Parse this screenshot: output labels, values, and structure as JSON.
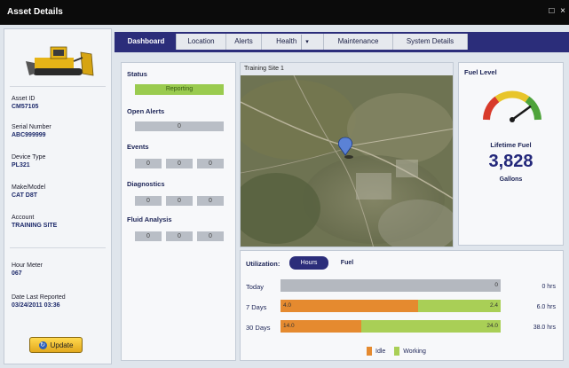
{
  "window": {
    "title": "Asset Details",
    "controls": [
      "□",
      "×"
    ]
  },
  "asset": {
    "fields": [
      {
        "label": "Asset ID",
        "value": "CM57105"
      },
      {
        "label": "Serial Number",
        "value": "ABC999999"
      },
      {
        "label": "Device Type",
        "value": "PL321"
      },
      {
        "label": "Make/Model",
        "value": "CAT D8T"
      },
      {
        "label": "Account",
        "value": "TRAINING SITE"
      },
      {
        "label": "Hour Meter",
        "value": "067"
      },
      {
        "label": "Date Last Reported",
        "value": "03/24/2011 03:36"
      }
    ],
    "update_label": "Update",
    "update_icon": "refresh-icon"
  },
  "tabs": [
    {
      "label": "Dashboard",
      "active": true
    },
    {
      "label": "Location"
    },
    {
      "label": "Alerts"
    },
    {
      "label": "Health",
      "dropdown": "▾"
    },
    {
      "label": "Maintenance"
    },
    {
      "label": "System Details"
    }
  ],
  "status": {
    "status_title": "Status",
    "status_value": "Reporting",
    "open_alerts_title": "Open Alerts",
    "open_alerts_value": "0",
    "events_title": "Events",
    "events_values": [
      "0",
      "0",
      "0"
    ],
    "diagnostics_title": "Diagnostics",
    "diagnostics_values": [
      "0",
      "0",
      "0"
    ],
    "fluid_title": "Fluid Analysis",
    "fluid_values": [
      "0",
      "0",
      "0"
    ]
  },
  "map": {
    "title": "Training Site 1",
    "pin_icon": "map-pin-icon"
  },
  "fuel": {
    "title": "Fuel Level",
    "level_fraction": 0.8,
    "lifetime_label": "Lifetime Fuel",
    "lifetime_value": "3,828",
    "unit": "Gallons"
  },
  "utilization": {
    "title": "Utilization:",
    "hours_label": "Hours",
    "fuel_label": "Fuel",
    "rows": [
      {
        "label": "Today",
        "idle": null,
        "working": null,
        "single": "0",
        "total": "0 hrs"
      },
      {
        "label": "7 Days",
        "idle": "4.0",
        "working": "2.4",
        "idle_val": 4.0,
        "work_val": 2.4,
        "total": "6.0 hrs"
      },
      {
        "label": "30 Days",
        "idle": "14.0",
        "working": "24.0",
        "idle_val": 14.0,
        "work_val": 24.0,
        "total": "38.0 hrs"
      }
    ],
    "legend_idle": "Idle",
    "legend_working": "Working",
    "colors": {
      "idle": "#e58a2f",
      "working": "#a9cf56",
      "empty": "#b4b8bf"
    }
  }
}
